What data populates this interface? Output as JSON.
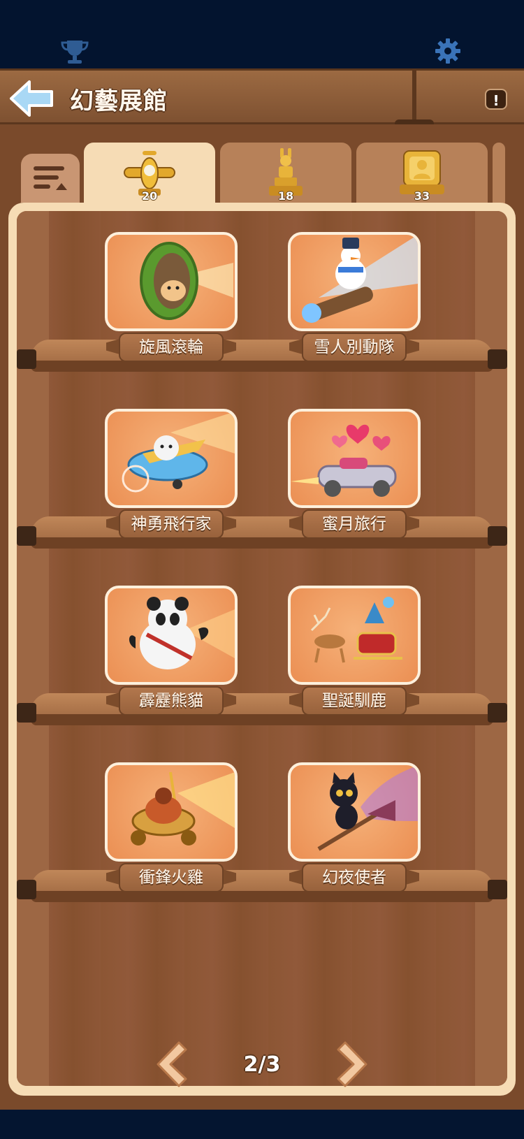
{
  "status_bar": {
    "left_icon": "trophy-icon",
    "right_icon": "gear-icon"
  },
  "header": {
    "title": "幻藝展館",
    "back_icon": "back-arrow-icon",
    "info_icon": "!"
  },
  "tabs": [
    {
      "icon": "airplane-icon",
      "count": "20",
      "active": true
    },
    {
      "icon": "rabbit-trophy-icon",
      "count": "18",
      "active": false
    },
    {
      "icon": "portrait-frame-icon",
      "count": "33",
      "active": false
    }
  ],
  "sort_icon": "sort-list-icon",
  "items": [
    {
      "label": "旋風滾輪"
    },
    {
      "label": "雪人別動隊"
    },
    {
      "label": "神勇飛行家"
    },
    {
      "label": "蜜月旅行"
    },
    {
      "label": "霹靂熊貓"
    },
    {
      "label": "聖誕馴鹿"
    },
    {
      "label": "衝鋒火雞"
    },
    {
      "label": "幻夜使者"
    }
  ],
  "pager": {
    "current": "2/3",
    "prev_icon": "chevron-left-icon",
    "next_icon": "chevron-right-icon"
  },
  "colors": {
    "background": "#041530",
    "wood": "#8c5634",
    "card": "#f6b27a",
    "frame": "#f6dcb5"
  }
}
